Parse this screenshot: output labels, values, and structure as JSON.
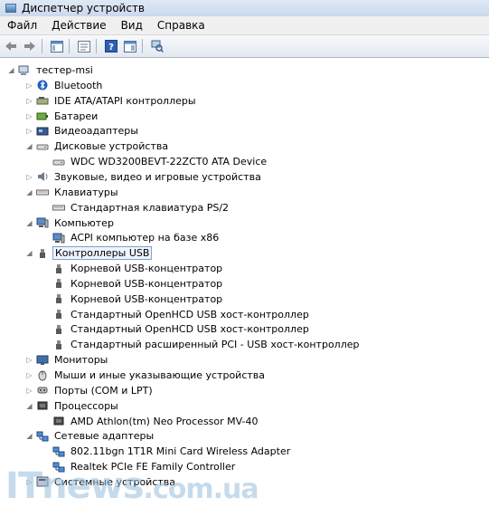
{
  "window": {
    "title": "Диспетчер устройств"
  },
  "menu": [
    "Файл",
    "Действие",
    "Вид",
    "Справка"
  ],
  "toolbar": [
    "back-icon",
    "forward-icon",
    "console-tree-icon",
    "properties-icon",
    "help-icon",
    "show-hide-icon",
    "scan-hardware-icon"
  ],
  "tree": [
    {
      "text": "тестер-msi",
      "level": 0,
      "exp": "◢",
      "icon": "computer-root-icon"
    },
    {
      "text": "Bluetooth",
      "level": 1,
      "exp": "▷",
      "icon": "bluetooth-icon"
    },
    {
      "text": "IDE ATA/ATAPI контроллеры",
      "level": 1,
      "exp": "▷",
      "icon": "ide-controller-icon"
    },
    {
      "text": "Батареи",
      "level": 1,
      "exp": "▷",
      "icon": "battery-icon"
    },
    {
      "text": "Видеоадаптеры",
      "level": 1,
      "exp": "▷",
      "icon": "display-adapter-icon"
    },
    {
      "text": "Дисковые устройства",
      "level": 1,
      "exp": "◢",
      "icon": "disk-drive-icon"
    },
    {
      "text": "WDC WD3200BEVT-22ZCT0 ATA Device",
      "level": 2,
      "exp": "",
      "icon": "disk-drive-icon"
    },
    {
      "text": "Звуковые, видео и игровые устройства",
      "level": 1,
      "exp": "▷",
      "icon": "sound-icon"
    },
    {
      "text": "Клавиатуры",
      "level": 1,
      "exp": "◢",
      "icon": "keyboard-icon"
    },
    {
      "text": "Стандартная клавиатура PS/2",
      "level": 2,
      "exp": "",
      "icon": "keyboard-icon"
    },
    {
      "text": "Компьютер",
      "level": 1,
      "exp": "◢",
      "icon": "computer-icon"
    },
    {
      "text": "ACPI компьютер на базе x86",
      "level": 2,
      "exp": "",
      "icon": "computer-icon"
    },
    {
      "text": "Контроллеры USB",
      "level": 1,
      "exp": "◢",
      "icon": "usb-icon",
      "selected": true
    },
    {
      "text": "Корневой USB-концентратор",
      "level": 2,
      "exp": "",
      "icon": "usb-icon"
    },
    {
      "text": "Корневой USB-концентратор",
      "level": 2,
      "exp": "",
      "icon": "usb-icon"
    },
    {
      "text": "Корневой USB-концентратор",
      "level": 2,
      "exp": "",
      "icon": "usb-icon"
    },
    {
      "text": "Стандартный OpenHCD USB хост-контроллер",
      "level": 2,
      "exp": "",
      "icon": "usb-icon"
    },
    {
      "text": "Стандартный OpenHCD USB хост-контроллер",
      "level": 2,
      "exp": "",
      "icon": "usb-icon"
    },
    {
      "text": "Стандартный расширенный PCI - USB хост-контроллер",
      "level": 2,
      "exp": "",
      "icon": "usb-icon"
    },
    {
      "text": "Мониторы",
      "level": 1,
      "exp": "▷",
      "icon": "monitor-icon"
    },
    {
      "text": "Мыши и иные указывающие устройства",
      "level": 1,
      "exp": "▷",
      "icon": "mouse-icon"
    },
    {
      "text": "Порты (COM и LPT)",
      "level": 1,
      "exp": "▷",
      "icon": "port-icon"
    },
    {
      "text": "Процессоры",
      "level": 1,
      "exp": "◢",
      "icon": "processor-icon"
    },
    {
      "text": "AMD Athlon(tm) Neo Processor MV-40",
      "level": 2,
      "exp": "",
      "icon": "processor-icon"
    },
    {
      "text": "Сетевые адаптеры",
      "level": 1,
      "exp": "◢",
      "icon": "network-adapter-icon"
    },
    {
      "text": "802.11bgn 1T1R Mini Card Wireless Adapter",
      "level": 2,
      "exp": "",
      "icon": "network-adapter-icon"
    },
    {
      "text": "Realtek PCIe FE Family Controller",
      "level": 2,
      "exp": "",
      "icon": "network-adapter-icon"
    },
    {
      "text": "Системные устройства",
      "level": 1,
      "exp": "▷",
      "icon": "system-devices-icon"
    }
  ],
  "watermark": {
    "main": "ITnews",
    "suffix": ".com.ua"
  }
}
